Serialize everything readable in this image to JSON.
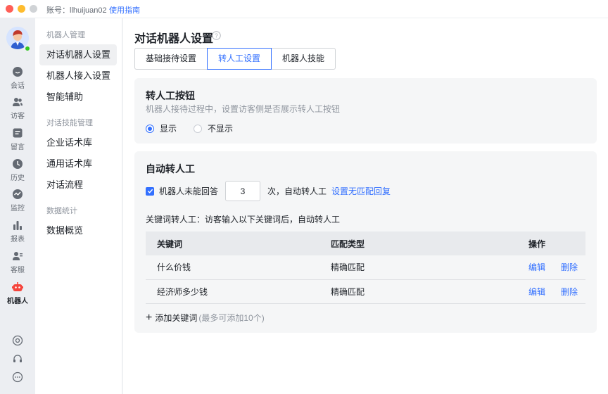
{
  "titlebar": {
    "account": "账号：llhuijuan02",
    "guide": "使用指南",
    "colors": {
      "close": "#ff5f57",
      "minimize": "#febc2e",
      "zoom": "#d0d3d6"
    }
  },
  "rail": {
    "items": [
      {
        "label": "会话",
        "icon": "chat-icon"
      },
      {
        "label": "访客",
        "icon": "visitors-icon"
      },
      {
        "label": "留言",
        "icon": "message-icon"
      },
      {
        "label": "历史",
        "icon": "history-icon"
      },
      {
        "label": "监控",
        "icon": "monitor-icon"
      },
      {
        "label": "报表",
        "icon": "report-icon"
      },
      {
        "label": "客服",
        "icon": "agent-icon"
      },
      {
        "label": "机器人",
        "icon": "robot-icon"
      }
    ],
    "bottom_icons": [
      "target-icon",
      "headset-icon",
      "more-icon"
    ]
  },
  "nav": {
    "sections": [
      {
        "title": "机器人管理",
        "items": [
          "对话机器人设置",
          "机器人接入设置",
          "智能辅助"
        ]
      },
      {
        "title": "对话技能管理",
        "items": [
          "企业话术库",
          "通用话术库",
          "对话流程"
        ]
      },
      {
        "title": "数据统计",
        "items": [
          "数据概览"
        ]
      }
    ]
  },
  "main": {
    "title": "对话机器人设置",
    "tabs": [
      "基础接待设置",
      "转人工设置",
      "机器人技能"
    ],
    "active_tab": "转人工设置",
    "transfer_button": {
      "title": "转人工按钮",
      "desc": "机器人接待过程中，设置访客侧是否展示转人工按钮",
      "options": [
        "显示",
        "不显示"
      ],
      "selected": "显示"
    },
    "auto_transfer": {
      "title": "自动转人工",
      "check_label": "机器人未能回答",
      "count": "3",
      "suffix": "次，自动转人工",
      "link": "设置无匹配回复",
      "keyword_title": "关键词转人工：访客输入以下关键词后，自动转人工",
      "columns": [
        "关键词",
        "匹配类型",
        "操作"
      ],
      "rows": [
        {
          "keyword": "什么价钱",
          "type": "精确匹配",
          "edit": "编辑",
          "delete": "删除"
        },
        {
          "keyword": "经济师多少钱",
          "type": "精确匹配",
          "edit": "编辑",
          "delete": "删除"
        }
      ],
      "add_label": "添加关键词",
      "add_hint": "(最多可添加10个)"
    }
  },
  "colors": {
    "accent": "#3370ff",
    "robot": "#f5443c",
    "online": "#34c724"
  }
}
